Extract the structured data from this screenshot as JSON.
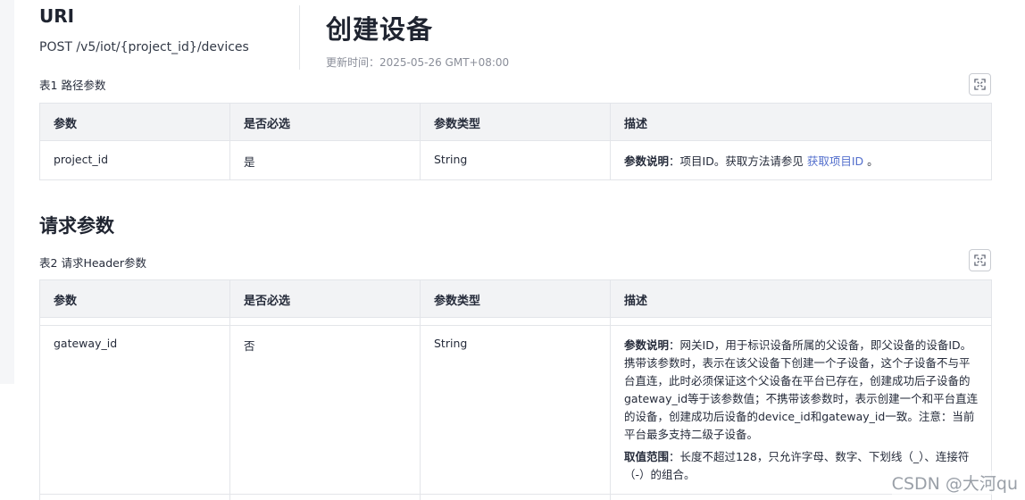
{
  "uri": {
    "heading": "URI",
    "method_path": "POST /v5/iot/{project_id}/devices"
  },
  "doc": {
    "title": "创建设备",
    "updated": "更新时间：2025-05-26 GMT+08:00"
  },
  "table1": {
    "caption_no": "表1",
    "caption": "路径参数",
    "headers": [
      "参数",
      "是否必选",
      "参数类型",
      "描述"
    ],
    "rows": [
      {
        "param": "project_id",
        "required": "是",
        "type": "String",
        "desc_label": "参数说明",
        "desc_text": "：项目ID。获取方法请参见 ",
        "desc_link": "获取项目ID",
        "desc_end": " 。"
      }
    ]
  },
  "section2": {
    "title": "请求参数"
  },
  "table2": {
    "caption_no": "表2",
    "caption": "请求Header参数",
    "headers": [
      "参数",
      "是否必选",
      "参数类型",
      "描述"
    ],
    "rows": [
      {
        "param": "gateway_id",
        "required": "否",
        "type": "String",
        "desc_label": "参数说明",
        "desc_text": "：网关ID，用于标识设备所属的父设备，即父设备的设备ID。携带该参数时，表示在该父设备下创建一个子设备，这个子设备不与平台直连，此时必须保证这个父设备在平台已存在，创建成功后子设备的gateway_id等于该参数值；不携带该参数时，表示创建一个和平台直连的设备，创建成功后设备的device_id和gateway_id一致。注意：当前平台最多支持二级子设备。",
        "range_label": "取值范围",
        "range_text": "：长度不超过128，只允许字母、数字、下划线（_）、连接符（-）的组合。"
      }
    ]
  },
  "watermark": "CSDN @大河qu"
}
